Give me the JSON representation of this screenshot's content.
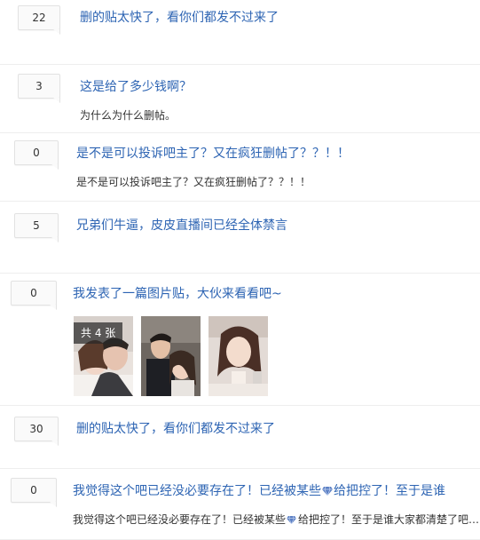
{
  "posts": [
    {
      "reply_count": "22",
      "title": "删的贴太快了，看你们都发不过来了",
      "excerpt": ""
    },
    {
      "reply_count": "3",
      "title": "这是给了多少钱啊？",
      "excerpt": "为什么为什么删帖。"
    },
    {
      "reply_count": "0",
      "title": "是不是可以投诉吧主了？又在疯狂删帖了？？！！",
      "excerpt": "是不是可以投诉吧主了？又在疯狂删帖了？？！！"
    },
    {
      "reply_count": "5",
      "title": "兄弟们牛逼，皮皮直播间已经全体禁言",
      "excerpt": ""
    },
    {
      "reply_count": "0",
      "title": "我发表了一篇图片贴，大伙来看看吧~",
      "excerpt": "",
      "image_count_label": "共 4 张",
      "images": [
        "couple-photo",
        "selfie-photo",
        "portrait-photo"
      ]
    },
    {
      "reply_count": "30",
      "title": "删的贴太快了，看你们都发不过来了",
      "excerpt": ""
    },
    {
      "reply_count": "0",
      "title_before": "我觉得这个吧已经没必要存在了！已经被某些",
      "title_after": "给把控了！至于是谁",
      "excerpt_before": "我觉得这个吧已经没必要存在了！已经被某些",
      "excerpt_after": "给把控了！至于是谁大家都清楚了吧…",
      "inline_icon": "gem-icon"
    }
  ],
  "colors": {
    "title": "#2d64b3",
    "text": "#333333",
    "divider": "#eeeeee"
  }
}
